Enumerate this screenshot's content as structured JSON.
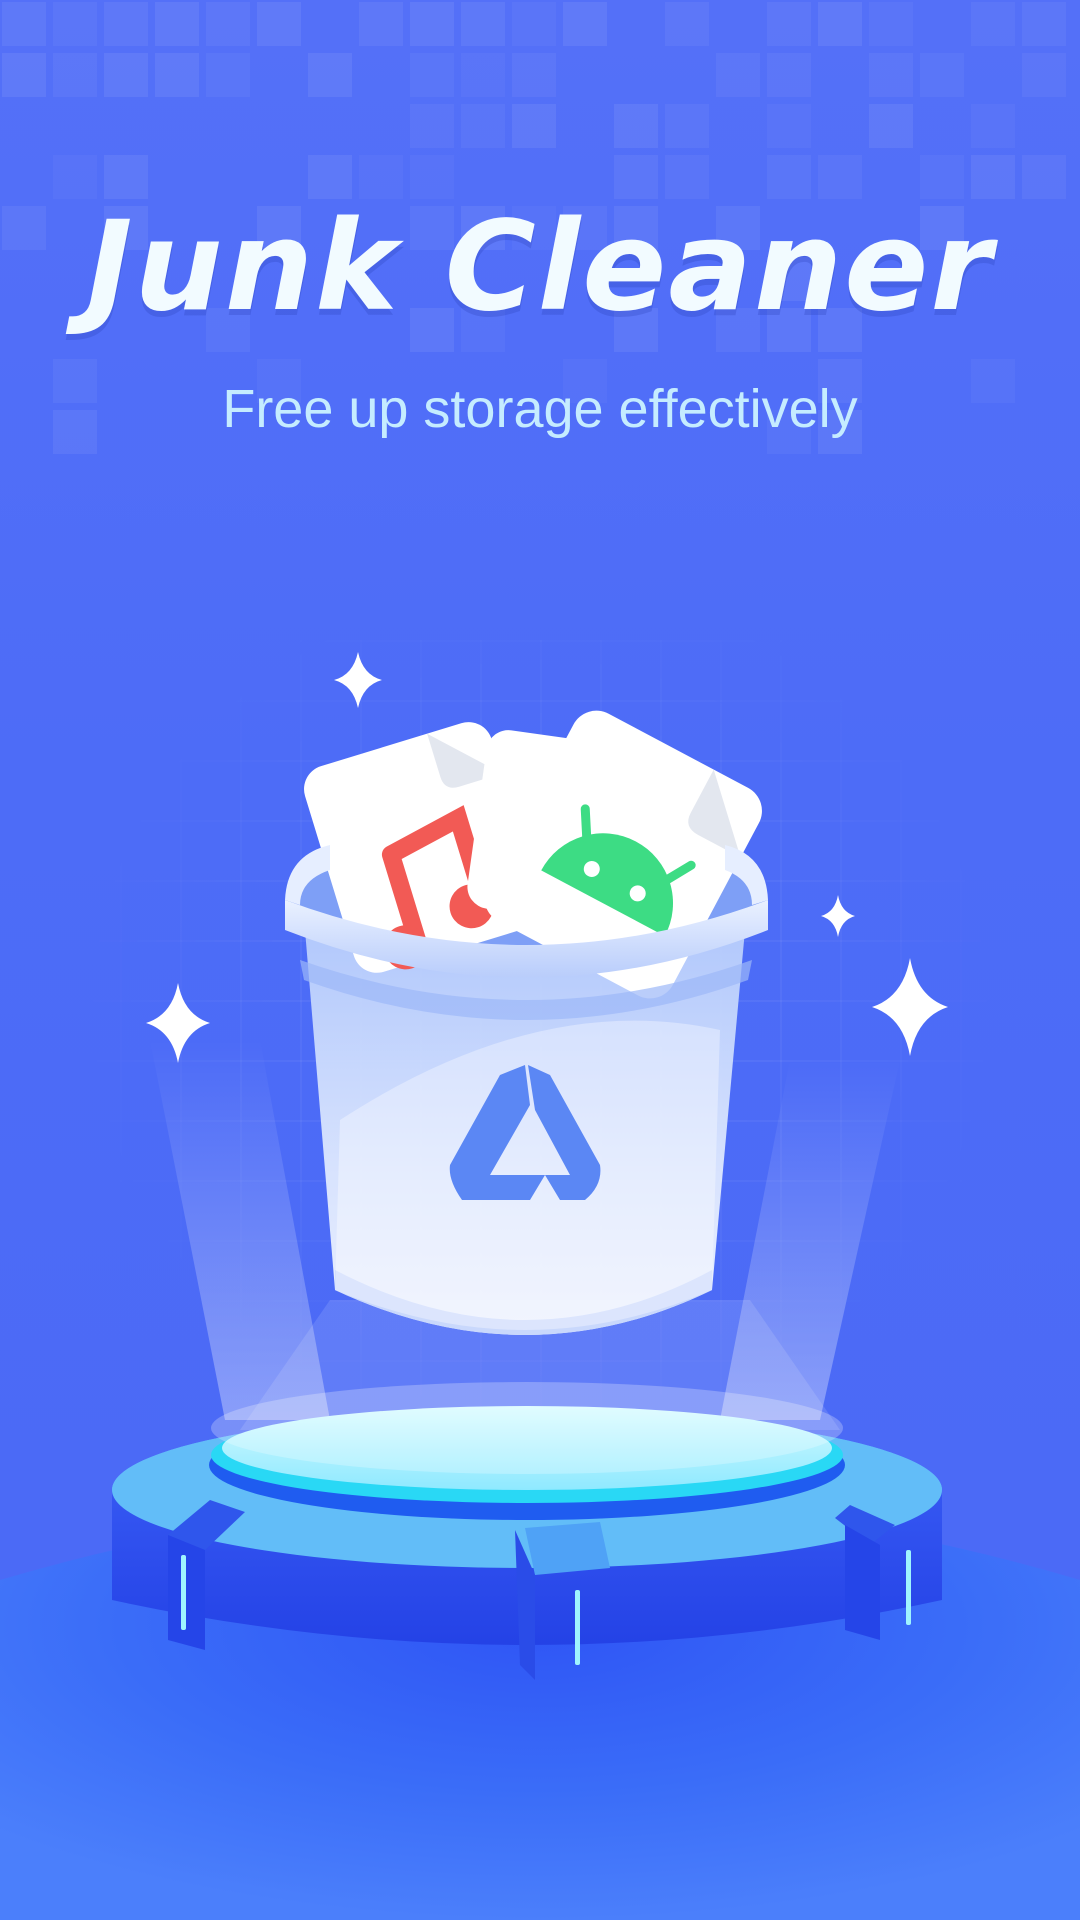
{
  "screen": {
    "title": "Junk Cleaner",
    "subtitle": "Free up storage effectively"
  },
  "illustration": {
    "icons": [
      "trash-bin-icon",
      "music-file-icon",
      "android-file-icon",
      "recycle-logo-icon",
      "sparkle-icon",
      "podium-icon"
    ]
  },
  "colors": {
    "background": "#4f6ef7",
    "title": "#f2fbff",
    "subtitle": "#c5ecff",
    "music_accent": "#f25a55",
    "android_accent": "#3ddc84",
    "podium_glow": "#9ff4ff"
  }
}
